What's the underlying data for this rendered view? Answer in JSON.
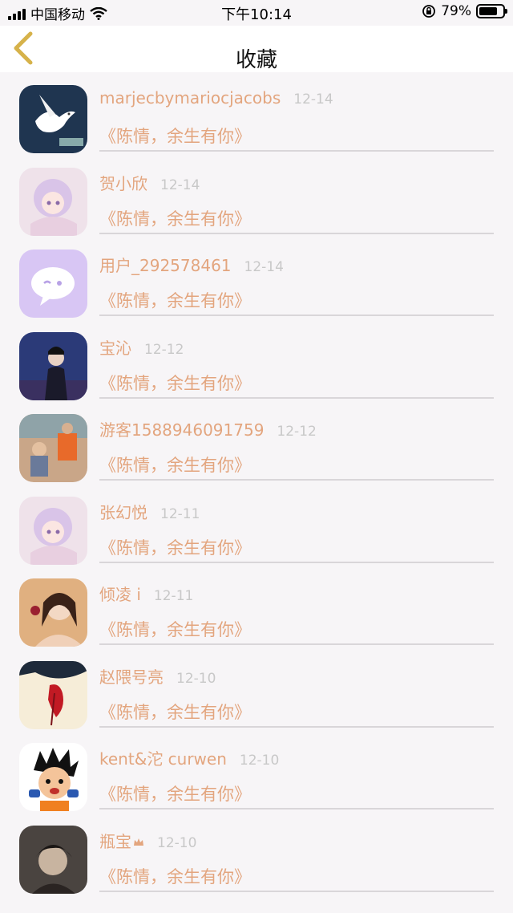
{
  "status_bar": {
    "carrier": "中国移动",
    "time": "下午10:14",
    "battery_text": "79%",
    "battery_level": 0.79
  },
  "header": {
    "title": "收藏"
  },
  "favorites": [
    {
      "user": "marjecbymariocjacobs",
      "date": "12-14",
      "book": "《陈情，余生有你》",
      "avatar": "dove-avatar"
    },
    {
      "user": "贺小欣",
      "date": "12-14",
      "book": "《陈情，余生有你》",
      "avatar": "anime-girl-avatar"
    },
    {
      "user": "用户_292578461",
      "date": "12-14",
      "book": "《陈情，余生有你》",
      "avatar": "chat-bubble-avatar"
    },
    {
      "user": "宝沁",
      "date": "12-12",
      "book": "《陈情，余生有你》",
      "avatar": "costume-man-avatar"
    },
    {
      "user": "游客1588946091759",
      "date": "12-12",
      "book": "《陈情，余生有你》",
      "avatar": "children-photo-avatar"
    },
    {
      "user": "张幻悦",
      "date": "12-11",
      "book": "《陈情，余生有你》",
      "avatar": "anime-girl-avatar"
    },
    {
      "user": "倾凌 i",
      "date": "12-11",
      "book": "《陈情，余生有你》",
      "avatar": "girl-photo-avatar"
    },
    {
      "user": "赵隈号亮",
      "date": "12-10",
      "book": "《陈情，余生有你》",
      "avatar": "ink-art-avatar"
    },
    {
      "user": "kent&沱 curwen",
      "date": "12-10",
      "book": "《陈情，余生有你》",
      "avatar": "cartoon-boy-avatar"
    },
    {
      "user": "瓶宝",
      "date": "12-10",
      "book": "《陈情，余生有你》",
      "avatar": "dark-portrait-avatar",
      "badge": "crown-icon"
    }
  ],
  "colors": {
    "accent": "#e3a57e",
    "back_arrow": "#d6b24a",
    "date": "#c8c8c8",
    "divider": "#d9d6d9"
  }
}
